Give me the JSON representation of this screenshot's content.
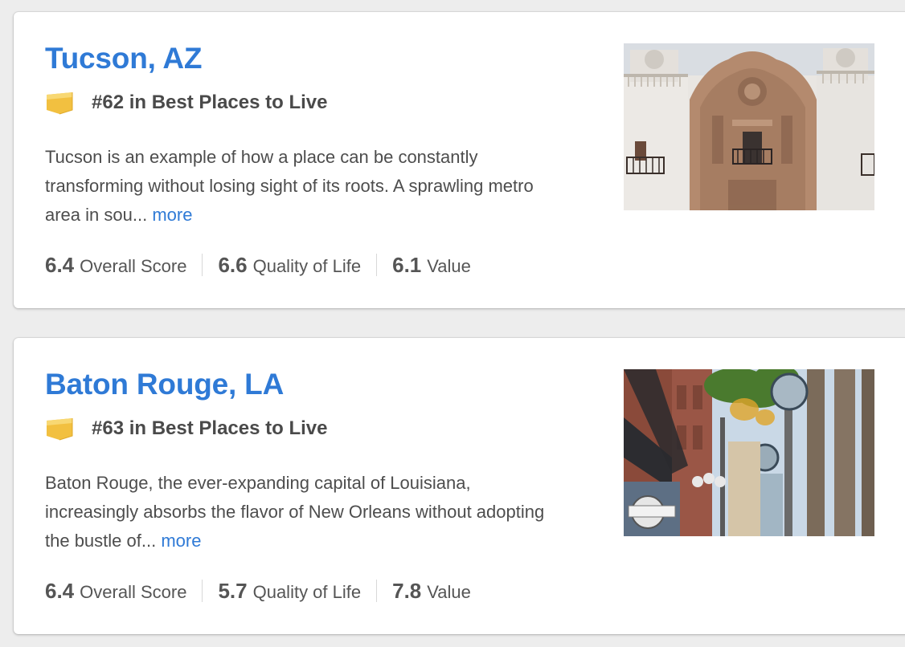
{
  "listings": [
    {
      "city": "Tucson, AZ",
      "rank": "#62 in Best Places to Live",
      "description": "Tucson is an example of how a place can be constantly transforming without losing sight of its roots. A sprawling metro area in sou...",
      "more_label": "more",
      "scores": [
        {
          "value": "6.4",
          "label": "Overall Score"
        },
        {
          "value": "6.6",
          "label": "Quality of Life"
        },
        {
          "value": "6.1",
          "label": "Value"
        }
      ]
    },
    {
      "city": "Baton Rouge, LA",
      "rank": "#63 in Best Places to Live",
      "description": "Baton Rouge, the ever-expanding capital of Louisiana, increasingly absorbs the flavor of New Orleans without adopting the bustle of...",
      "more_label": "more",
      "scores": [
        {
          "value": "6.4",
          "label": "Overall Score"
        },
        {
          "value": "5.7",
          "label": "Quality of Life"
        },
        {
          "value": "7.8",
          "label": "Value"
        }
      ]
    }
  ],
  "colors": {
    "link": "#2f7ad6",
    "badge": "#f5c542",
    "text": "#4d4d4d"
  },
  "icons": {
    "rank_badge": "ribbon-badge-icon"
  }
}
